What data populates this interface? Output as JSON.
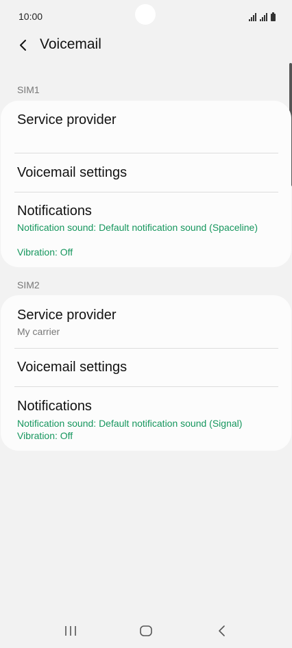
{
  "status_bar": {
    "time": "10:00"
  },
  "header": {
    "back_icon": "chevron-left-icon",
    "title": "Voicemail"
  },
  "sim1": {
    "label": "SIM1",
    "service_provider": {
      "title": "Service provider",
      "value": ""
    },
    "voicemail_settings": {
      "title": "Voicemail settings"
    },
    "notifications": {
      "title": "Notifications",
      "sound": "Notification sound: Default notification sound (Spaceline)",
      "vibration": "Vibration: Off"
    }
  },
  "sim2": {
    "label": "SIM2",
    "service_provider": {
      "title": "Service provider",
      "value": "My carrier"
    },
    "voicemail_settings": {
      "title": "Voicemail settings"
    },
    "notifications": {
      "title": "Notifications",
      "sound": "Notification sound: Default notification sound (Signal)",
      "vibration": "Vibration: Off"
    }
  },
  "nav_bar": {
    "recents_icon": "recents-icon",
    "home_icon": "home-icon",
    "back_icon": "back-icon"
  },
  "colors": {
    "background": "#f2f2f2",
    "card": "#fcfcfc",
    "accent_green": "#15965d",
    "secondary_text": "#777777"
  }
}
